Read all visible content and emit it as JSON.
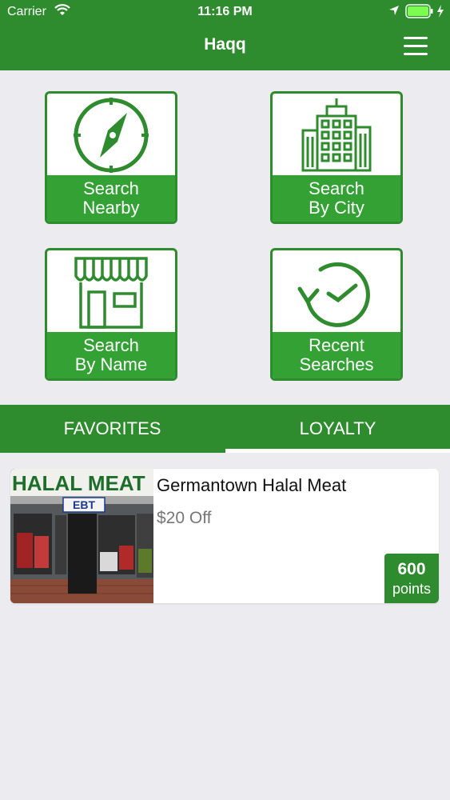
{
  "status": {
    "carrier": "Carrier",
    "time": "11:16 PM"
  },
  "header": {
    "title": "Haqq"
  },
  "tiles": [
    {
      "label": "Search\nNearby",
      "icon": "compass-icon"
    },
    {
      "label": "Search\nBy City",
      "icon": "city-building-icon"
    },
    {
      "label": "Search\nBy Name",
      "icon": "storefront-icon"
    },
    {
      "label": "Recent\nSearches",
      "icon": "history-clock-icon"
    }
  ],
  "tabs": [
    {
      "label": "FAVORITES"
    },
    {
      "label": "LOYALTY",
      "active": true
    }
  ],
  "card": {
    "name": "Germantown Halal Meat",
    "offer": "$20 Off",
    "points": "600",
    "points_unit": "points",
    "photo_sign": "HALAL MEAT",
    "photo_badge": "EBT"
  },
  "colors": {
    "brand_green": "#2e8b2e",
    "tile_label_green": "#33a133",
    "background": "#ececf0"
  }
}
